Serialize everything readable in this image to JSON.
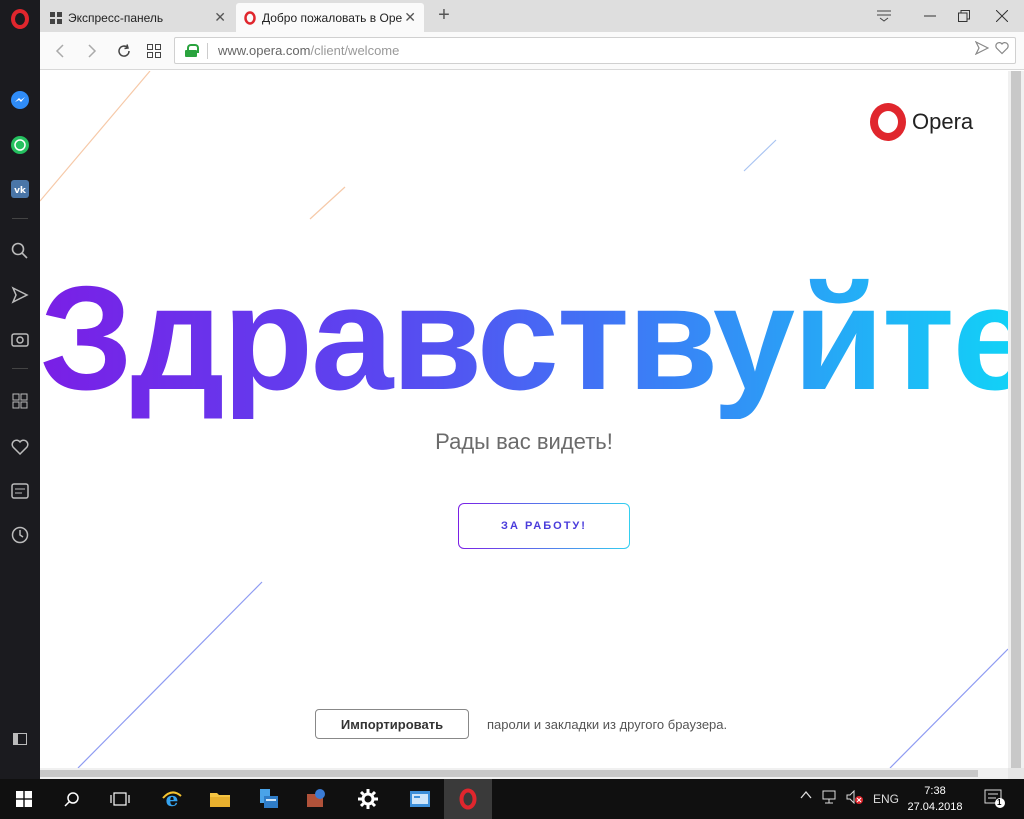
{
  "tabs": [
    {
      "title": "Экспресс-панель",
      "icon": "grid-icon"
    },
    {
      "title": "Добро пожаловать в Opera",
      "icon": "opera-icon"
    }
  ],
  "address": {
    "host": "www.opera.com",
    "path": "/client/welcome"
  },
  "brand": {
    "word": "Opera",
    "color": "#e0262d"
  },
  "main": {
    "headline": "Здравствуйте!",
    "subtitle": "Рады вас видеть!",
    "start_label": "ЗА РАБОТУ!",
    "import_label": "Импортировать",
    "import_desc": "пароли и закладки из другого браузера."
  },
  "taskbar": {
    "lang": "ENG",
    "time": "7:38",
    "date": "27.04.2018",
    "notif_count": "1"
  },
  "colors": {
    "gradient_start": "#7a1fe6",
    "gradient_end": "#12d1f7",
    "accent_red": "#e0262d"
  }
}
